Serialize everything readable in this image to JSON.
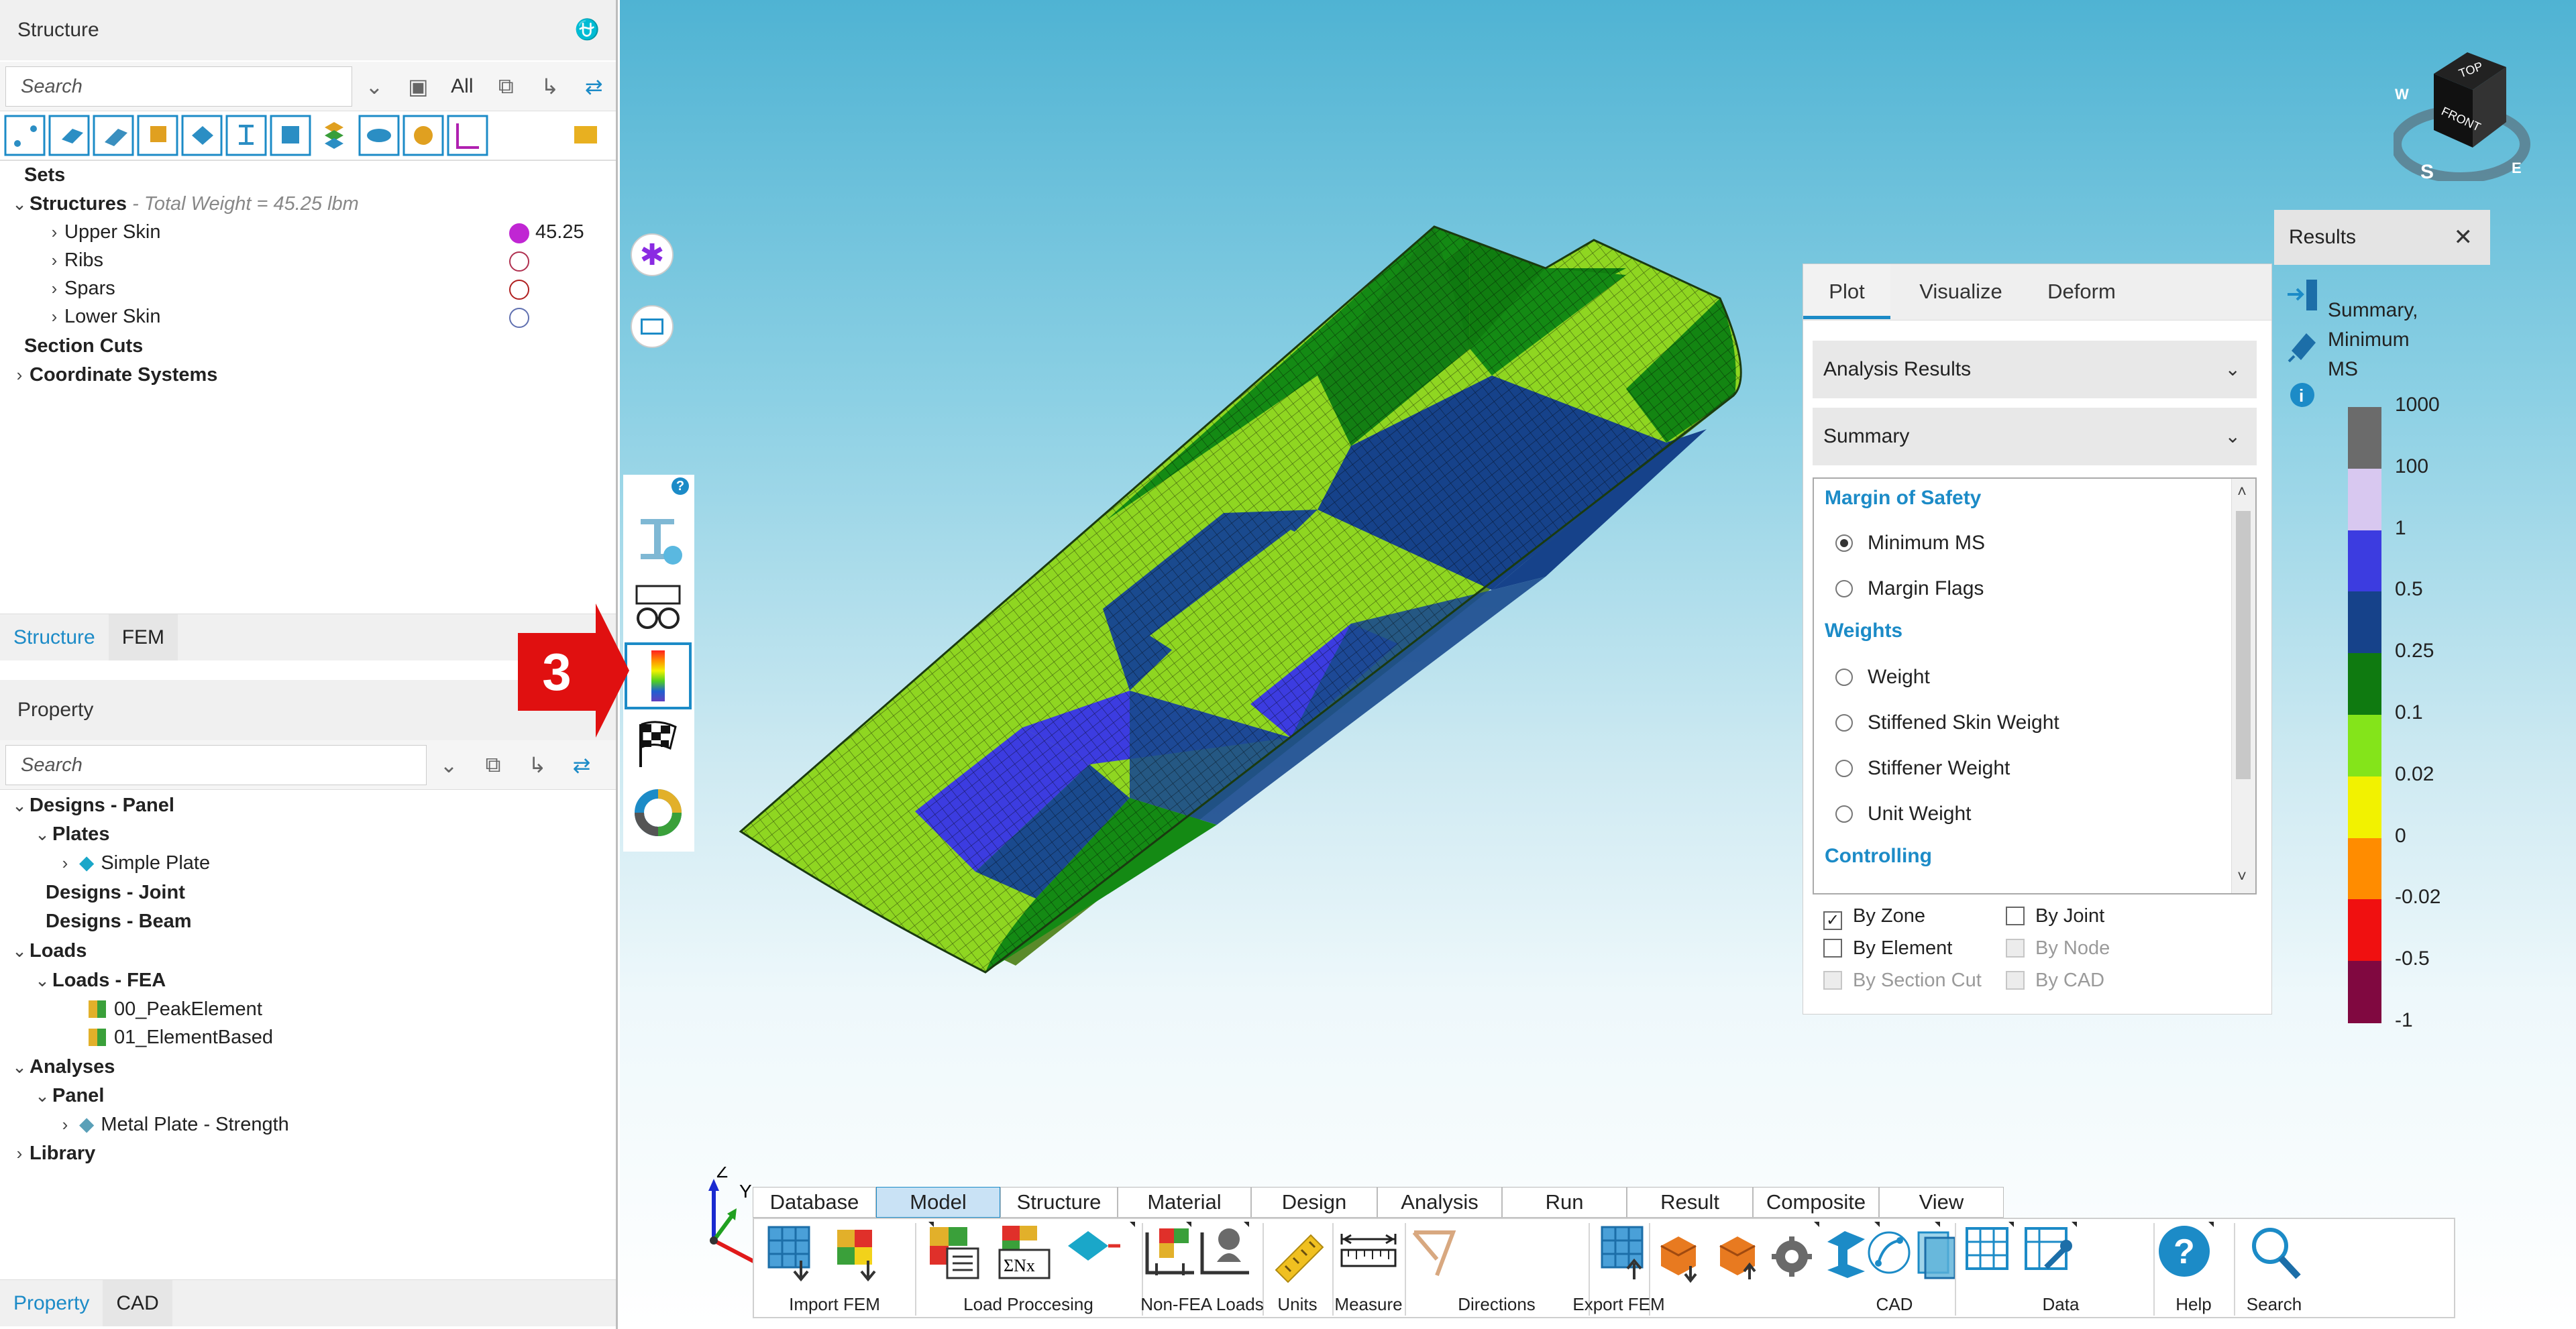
{
  "structure_panel": {
    "title": "Structure",
    "pin_icon": "pin-icon",
    "search_placeholder": "Search",
    "filter_all": "All",
    "tree": {
      "sets": "Sets",
      "structures": "Structures",
      "structures_note": " - Total Weight = 45.25 lbm",
      "children": [
        {
          "label": "Upper Skin",
          "value": "45.25",
          "color": "#c026d3",
          "filled": true
        },
        {
          "label": "Ribs",
          "value": "",
          "color": "#b03050",
          "filled": false
        },
        {
          "label": "Spars",
          "value": "",
          "color": "#b02020",
          "filled": false
        },
        {
          "label": "Lower Skin",
          "value": "",
          "color": "#6070b0",
          "filled": false
        }
      ],
      "section_cuts": "Section Cuts",
      "coordinate_systems": "Coordinate Systems"
    },
    "tabs": [
      "Structure",
      "FEM"
    ]
  },
  "property_panel": {
    "title": "Property",
    "search_placeholder": "Search",
    "tree": {
      "designs_panel": "Designs - Panel",
      "plates": "Plates",
      "simple_plate": "Simple Plate",
      "designs_joint": "Designs - Joint",
      "designs_beam": "Designs - Beam",
      "loads": "Loads",
      "loads_fea": "Loads - FEA",
      "load_1": "00_PeakElement",
      "load_2": "01_ElementBased",
      "analyses": "Analyses",
      "panel": "Panel",
      "metal_plate": "Metal Plate - Strength",
      "library": "Library"
    },
    "tabs": [
      "Property",
      "CAD"
    ]
  },
  "callout": {
    "number": "3"
  },
  "plot_panel": {
    "tabs": [
      "Plot",
      "Visualize",
      "Deform"
    ],
    "active_tab": "Plot",
    "dropdown_1": "Analysis Results",
    "dropdown_2": "Summary",
    "list": {
      "group_1": "Margin of Safety",
      "minimum_ms": "Minimum MS",
      "margin_flags": "Margin Flags",
      "group_2": "Weights",
      "weight": "Weight",
      "stiffened_skin_weight": "Stiffened Skin Weight",
      "stiffener_weight": "Stiffener Weight",
      "unit_weight": "Unit Weight",
      "group_3": "Controlling"
    },
    "checkboxes": {
      "by_zone": "By Zone",
      "by_joint": "By Joint",
      "by_element": "By Element",
      "by_node": "By Node",
      "by_section_cut": "By Section Cut",
      "by_cad": "By CAD"
    }
  },
  "results_panel": {
    "title": "Results",
    "legend_title_1": "Summary,",
    "legend_title_2": "Minimum",
    "legend_title_3": "MS",
    "ticks": [
      "1000",
      "100",
      "1",
      "0.5",
      "0.25",
      "0.1",
      "0.02",
      "0",
      "-0.02",
      "-0.5",
      "-1"
    ],
    "colors": [
      "#6b6b6b",
      "#d8c8f0",
      "#3c3ce0",
      "#16428a",
      "#0f7a10",
      "#84e41a",
      "#f2f200",
      "#ff8c00",
      "#f01010",
      "#800840"
    ]
  },
  "view_cube": {
    "top": "TOP",
    "front": "FRONT",
    "compass_w": "W",
    "compass_s": "S",
    "compass_e": "E"
  },
  "axis_triad": {
    "z": "Z",
    "y": "Y"
  },
  "ribbon": {
    "tabs": [
      "Database",
      "Model",
      "Structure",
      "Material",
      "Design",
      "Analysis",
      "Run",
      "Result",
      "Composite",
      "View"
    ],
    "active_tab": "Model",
    "groups": [
      "Import FEM",
      "Load Proccesing",
      "Non-FEA Loads",
      "Units",
      "Measure",
      "Directions",
      "Export FEM",
      "CAD",
      "Data",
      "Help",
      "Search"
    ]
  }
}
